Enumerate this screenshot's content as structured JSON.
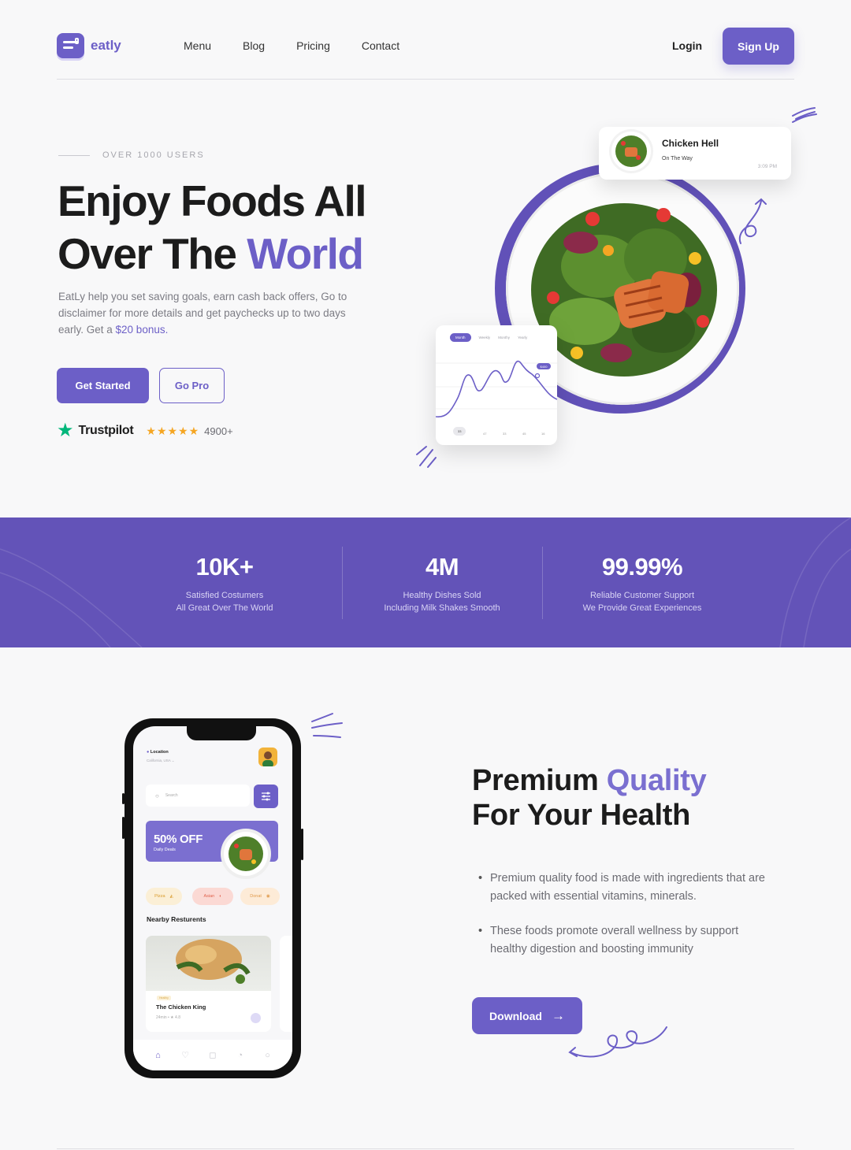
{
  "nav": {
    "logo_text": "eatly",
    "links": [
      "Menu",
      "Blog",
      "Pricing",
      "Contact"
    ],
    "login": "Login",
    "signup": "Sign Up"
  },
  "hero": {
    "eyebrow": "OVER 1000 USERS",
    "title_line1": "Enjoy Foods All",
    "title_line2_plain": "Over The ",
    "title_line2_accent": "World",
    "description": "EatLy help you set saving goals, earn cash back offers, Go to disclaimer for more details and get paychecks up to two days early. Get a ",
    "description_accent": "$20 bonus.",
    "primary_button": "Get Started",
    "secondary_button": "Go Pro",
    "trust_brand": "Trustpilot",
    "rating_stars": "★★★★★",
    "rating_count": "4900+"
  },
  "notification": {
    "title": "Chicken Hell",
    "subtitle": "On The Way",
    "time": "3:09 PM"
  },
  "mini_chart": {
    "tabs": [
      "Month",
      "Weekly",
      "Monthy",
      "Yearly"
    ],
    "badge": "$400",
    "x_labels": [
      "33",
      "47",
      "33",
      "45",
      "16"
    ]
  },
  "stats": [
    {
      "value": "10K+",
      "line1": "Satisfied Costumers",
      "line2": "All Great Over The World"
    },
    {
      "value": "4M",
      "line1": "Healthy Dishes Sold",
      "line2": "Including Milk Shakes Smooth"
    },
    {
      "value": "99.99%",
      "line1": "Reliable Customer Support",
      "line2": "We Provide Great Experiences"
    }
  ],
  "phone": {
    "location_label": "Location",
    "location_value": "California, USA",
    "search_placeholder": "Search",
    "promo_title": "50% OFF",
    "promo_sub": "Daily Deals",
    "chips": [
      "Pizza",
      "Asian",
      "Donat"
    ],
    "nearby_title": "Nearby Resturents",
    "restaurant": {
      "tag": "Healthy",
      "name": "The Chicken King",
      "meta": "24min •  ★ 4.8"
    }
  },
  "premium": {
    "title_accent_word": "Quality",
    "title_word1": "Premium ",
    "title_line2": "For Your Health",
    "bullets": [
      "Premium quality food is made with ingredients that are packed with essential vitamins, minerals.",
      "These foods promote overall wellness by support healthy digestion and boosting immunity"
    ],
    "download": "Download"
  },
  "colors": {
    "accent": "#6c5fc7",
    "band": "#6353b8",
    "background": "#f8f8f9"
  },
  "icons": [
    "logo-icon",
    "trustpilot-star-icon",
    "location-pin-icon",
    "search-icon",
    "filter-icon",
    "bookmark-icon",
    "home-icon",
    "heart-icon",
    "bag-icon",
    "bell-icon",
    "user-icon",
    "arrow-right-icon"
  ]
}
